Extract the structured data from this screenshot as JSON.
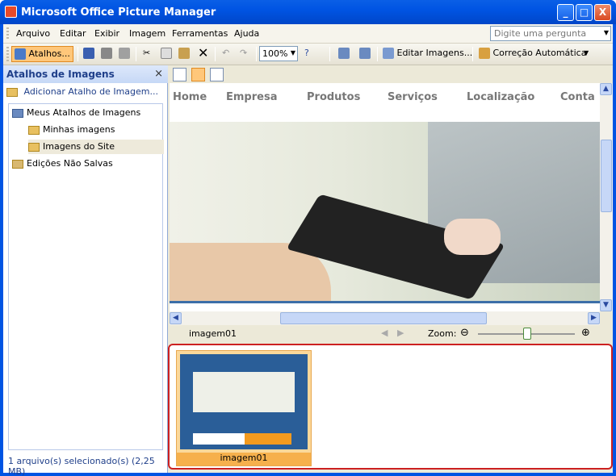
{
  "window": {
    "title": "Microsoft Office Picture Manager",
    "minimize": "_",
    "maximize": "□",
    "close": "X"
  },
  "menu": {
    "items": [
      "Arquivo",
      "Editar",
      "Exibir",
      "Imagem",
      "Ferramentas",
      "Ajuda"
    ],
    "ask_placeholder": "Digite uma pergunta"
  },
  "toolbar": {
    "shortcuts": "Atalhos...",
    "zoom": "100%",
    "edit_images": "Editar Imagens...",
    "auto_correct": "Correção Automática"
  },
  "left_pane": {
    "title": "Atalhos de Imagens",
    "close": "×",
    "add": "Adicionar Atalho de Imagem...",
    "tree": [
      {
        "label": "Meus Atalhos de Imagens"
      },
      {
        "label": "Minhas imagens"
      },
      {
        "label": "Imagens do Site"
      },
      {
        "label": "Edições Não Salvas"
      }
    ],
    "status": "1 arquivo(s) selecionado(s) (2,25 MB)"
  },
  "preview": {
    "nav": [
      "Home",
      "Empresa",
      "Produtos",
      "Serviços",
      "Localização",
      "Conta"
    ]
  },
  "infobar": {
    "filename": "imagem01",
    "zoom_label": "Zoom:"
  },
  "thumbnail": {
    "label": "imagem01"
  }
}
